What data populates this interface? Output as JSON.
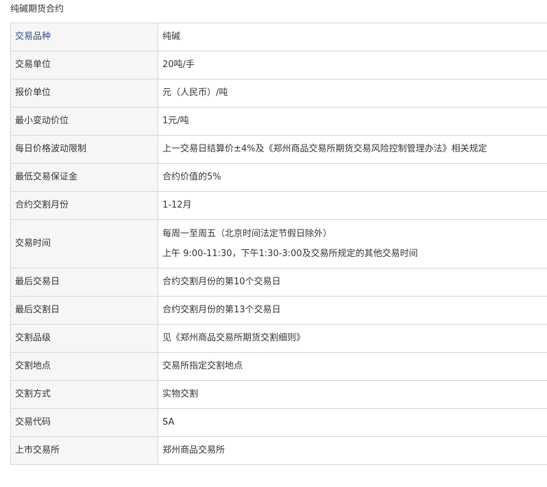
{
  "caption": "纯碱期货合约",
  "rows": [
    {
      "label": "交易品种",
      "value": "纯碱"
    },
    {
      "label": "交易单位",
      "value": "20吨/手"
    },
    {
      "label": "报价单位",
      "value": "元（人民币）/吨"
    },
    {
      "label": "最小变动价位",
      "value": "1元/吨"
    },
    {
      "label": "每日价格波动限制",
      "value": "上一交易日结算价±4%及《郑州商品交易所期货交易风险控制管理办法》相关规定"
    },
    {
      "label": "最低交易保证金",
      "value": "合约价值的5%"
    },
    {
      "label": "合约交割月份",
      "value": "1-12月"
    },
    {
      "label": "交易时间",
      "line1": "每周一至周五（北京时间法定节假日除外）",
      "line2": "上午 9:00-11:30，下午1:30-3:00及交易所规定的其他交易时间"
    },
    {
      "label": "最后交易日",
      "value": "合约交割月份的第10个交易日"
    },
    {
      "label": "最后交割日",
      "value": "合约交割月份的第13个交易日"
    },
    {
      "label": "交割品级",
      "value": "见《郑州商品交易所期货交割细则》"
    },
    {
      "label": "交割地点",
      "value": "交易所指定交割地点"
    },
    {
      "label": "交割方式",
      "value": "实物交割"
    },
    {
      "label": "交易代码",
      "value": "SA"
    },
    {
      "label": "上市交易所",
      "value": "郑州商品交易所"
    }
  ],
  "colors": {
    "header_label": "#2a4f8f",
    "label_background": "#f6f6f6",
    "border": "#d5d5d5",
    "text": "#333333"
  }
}
